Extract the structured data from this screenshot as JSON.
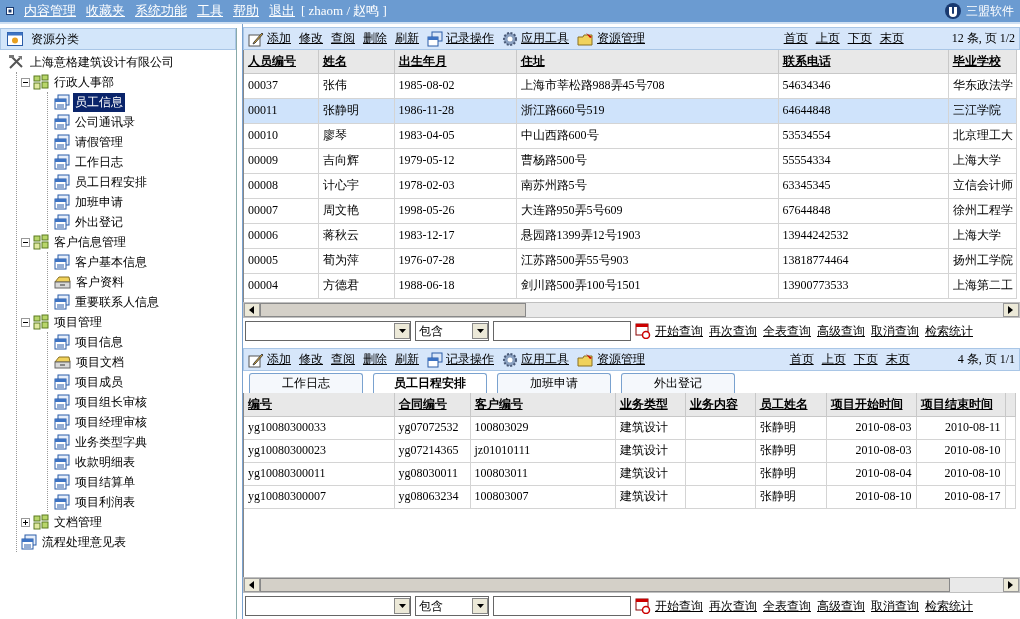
{
  "menu_bar": {
    "items": [
      "内容管理",
      "收藏夹",
      "系统功能",
      "工具",
      "帮助",
      "退出"
    ],
    "user": "[ zhaom / 赵鸣 ]",
    "logo": "三盟软件"
  },
  "sidebar": {
    "title": "资源分类",
    "tree": [
      {
        "label": "上海意格建筑设计有限公司",
        "kind": "root",
        "selected": false,
        "children": [
          {
            "label": "行政人事部",
            "kind": "group",
            "expanded": true,
            "selected": false,
            "children": [
              {
                "label": "员工信息",
                "kind": "page",
                "selected": true
              },
              {
                "label": "公司通讯录",
                "kind": "page",
                "selected": false
              },
              {
                "label": "请假管理",
                "kind": "page",
                "selected": false
              },
              {
                "label": "工作日志",
                "kind": "page",
                "selected": false
              },
              {
                "label": "员工日程安排",
                "kind": "page",
                "selected": false
              },
              {
                "label": "加班申请",
                "kind": "page",
                "selected": false
              },
              {
                "label": "外出登记",
                "kind": "page",
                "selected": false
              }
            ]
          },
          {
            "label": "客户信息管理",
            "kind": "group",
            "expanded": true,
            "selected": false,
            "children": [
              {
                "label": "客户基本信息",
                "kind": "page",
                "selected": false
              },
              {
                "label": "客户资料",
                "kind": "drawer",
                "selected": false
              },
              {
                "label": "重要联系人信息",
                "kind": "page",
                "selected": false
              }
            ]
          },
          {
            "label": "项目管理",
            "kind": "group",
            "expanded": true,
            "selected": false,
            "children": [
              {
                "label": "项目信息",
                "kind": "page",
                "selected": false
              },
              {
                "label": "项目文档",
                "kind": "drawer",
                "selected": false
              },
              {
                "label": "项目成员",
                "kind": "page",
                "selected": false
              },
              {
                "label": "项目组长审核",
                "kind": "page",
                "selected": false
              },
              {
                "label": "项目经理审核",
                "kind": "page",
                "selected": false
              },
              {
                "label": "业务类型字典",
                "kind": "page",
                "selected": false
              },
              {
                "label": "收款明细表",
                "kind": "page",
                "selected": false
              },
              {
                "label": "项目结算单",
                "kind": "page",
                "selected": false
              },
              {
                "label": "项目利润表",
                "kind": "page",
                "selected": false
              }
            ]
          },
          {
            "label": "文档管理",
            "kind": "group",
            "expanded": false,
            "selected": false
          },
          {
            "label": "流程处理意见表",
            "kind": "page",
            "selected": false
          }
        ]
      }
    ]
  },
  "upper_toolbar": {
    "actions": [
      {
        "label": "添加",
        "kind": "edit"
      },
      {
        "label": "修改",
        "kind": "plain"
      },
      {
        "label": "查阅",
        "kind": "plain"
      },
      {
        "label": "删除",
        "kind": "plain"
      },
      {
        "label": "刷新",
        "kind": "plain"
      },
      {
        "label": "记录操作",
        "kind": "record"
      },
      {
        "label": "应用工具",
        "kind": "tool"
      },
      {
        "label": "资源管理",
        "kind": "resource"
      }
    ],
    "pager": [
      "首页",
      "上页",
      "下页",
      "末页"
    ],
    "count": "12 条, 页 1/2"
  },
  "upper_table": {
    "columns": [
      "人员编号",
      "姓名",
      "出生年月",
      "住址",
      "联系电话",
      "毕业学校"
    ],
    "rows": [
      {
        "selected": false,
        "cells": [
          "00037",
          "张伟",
          "1985-08-02",
          "上海市莘松路988弄45号708",
          "54634346",
          "华东政法学"
        ]
      },
      {
        "selected": true,
        "cells": [
          "00011",
          "张静明",
          "1986-11-28",
          "浙江路660号519",
          "64644848",
          "三江学院"
        ]
      },
      {
        "selected": false,
        "cells": [
          "00010",
          "廖琴",
          "1983-04-05",
          "中山西路600号",
          "53534554",
          "北京理工大"
        ]
      },
      {
        "selected": false,
        "cells": [
          "00009",
          "吉向辉",
          "1979-05-12",
          "曹杨路500号",
          "55554334",
          "上海大学"
        ]
      },
      {
        "selected": false,
        "cells": [
          "00008",
          "计心宇",
          "1978-02-03",
          "南苏州路5号",
          "63345345",
          "立信会计师"
        ]
      },
      {
        "selected": false,
        "cells": [
          "00007",
          "周文艳",
          "1998-05-26",
          "大连路950弄5号609",
          "67644848",
          "徐州工程学"
        ]
      },
      {
        "selected": false,
        "cells": [
          "00006",
          "蒋秋云",
          "1983-12-17",
          "悬园路1399弄12号1903",
          "13944242532",
          "上海大学"
        ]
      },
      {
        "selected": false,
        "cells": [
          "00005",
          "荀为萍",
          "1976-07-28",
          "江苏路500弄55号903",
          "13818774464",
          "扬州工学院"
        ]
      },
      {
        "selected": false,
        "cells": [
          "00004",
          "方德君",
          "1988-06-18",
          "剑川路500弄100号1501",
          "13900773533",
          "上海第二工"
        ]
      }
    ]
  },
  "upper_search": {
    "operator": "包含",
    "actions": [
      "开始查询",
      "再次查询",
      "全表查询",
      "高级查询",
      "取消查询",
      "检索统计"
    ]
  },
  "lower_toolbar": {
    "actions": [
      {
        "label": "添加",
        "kind": "edit"
      },
      {
        "label": "修改",
        "kind": "plain"
      },
      {
        "label": "查阅",
        "kind": "plain"
      },
      {
        "label": "删除",
        "kind": "plain"
      },
      {
        "label": "刷新",
        "kind": "plain"
      },
      {
        "label": "记录操作",
        "kind": "record"
      },
      {
        "label": "应用工具",
        "kind": "tool"
      },
      {
        "label": "资源管理",
        "kind": "resource"
      }
    ],
    "pager": [
      "首页",
      "上页",
      "下页",
      "末页"
    ],
    "count": "4 条, 页 1/1"
  },
  "lower_tabs": [
    {
      "label": "工作日志",
      "selected": false
    },
    {
      "label": "员工日程安排",
      "selected": true
    },
    {
      "label": "加班申请",
      "selected": false
    },
    {
      "label": "外出登记",
      "selected": false
    }
  ],
  "lower_table": {
    "columns": [
      "编号",
      "合同编号",
      "客户编号",
      "业务类型",
      "业务内容",
      "员工姓名",
      "项目开始时间",
      "项目结束时间"
    ],
    "rows": [
      {
        "selected": false,
        "cells": [
          "yg10080300033",
          "yg07072532",
          "100803029",
          "建筑设计",
          "",
          "张静明",
          "2010-08-03",
          "2010-08-11"
        ]
      },
      {
        "selected": false,
        "cells": [
          "yg10080300023",
          "yg07214365",
          "jz01010111",
          "建筑设计",
          "",
          "张静明",
          "2010-08-03",
          "2010-08-10"
        ]
      },
      {
        "selected": false,
        "cells": [
          "yg10080300011",
          "yg08030011",
          "100803011",
          "建筑设计",
          "",
          "张静明",
          "2010-08-04",
          "2010-08-10"
        ]
      },
      {
        "selected": false,
        "cells": [
          "yg10080300007",
          "yg08063234",
          "100803007",
          "建筑设计",
          "",
          "张静明",
          "2010-08-10",
          "2010-08-17"
        ]
      }
    ]
  },
  "lower_search": {
    "operator": "包含",
    "actions": [
      "开始查询",
      "再次查询",
      "全表查询",
      "高级查询",
      "取消查询",
      "检索统计"
    ]
  }
}
